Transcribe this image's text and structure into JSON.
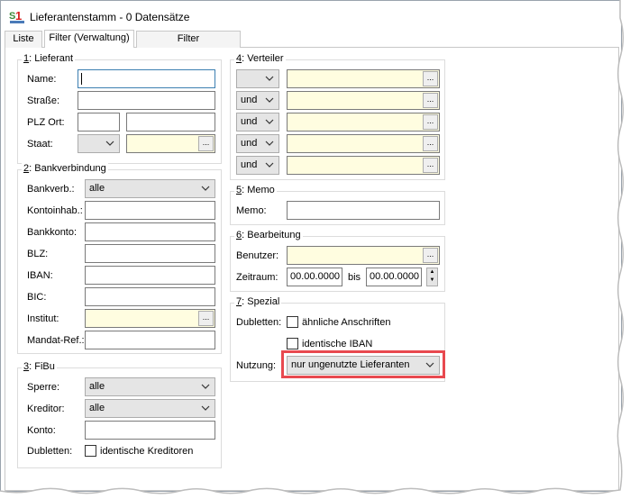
{
  "window": {
    "title": "Lieferantenstamm - 0 Datensätze"
  },
  "tabs": [
    {
      "label": "Liste"
    },
    {
      "label": "Filter (Verwaltung)"
    },
    {
      "label": "Filter (Ansprechpartner)"
    }
  ],
  "ellipsis": "...",
  "lieferant": {
    "num": "1",
    "title": ": Lieferant",
    "name_label": "Name:",
    "strasse_label": "Straße:",
    "plzort_label": "PLZ Ort:",
    "staat_label": "Staat:"
  },
  "bank": {
    "num": "2",
    "title": ": Bankverbindung",
    "bankverb_label": "Bankverb.:",
    "bankverb_value": "alle",
    "kontoinhab_label": "Kontoinhab.:",
    "bankkonto_label": "Bankkonto:",
    "blz_label": "BLZ:",
    "iban_label": "IBAN:",
    "bic_label": "BIC:",
    "institut_label": "Institut:",
    "mandat_label": "Mandat-Ref.:"
  },
  "fibu": {
    "num": "3",
    "title": ": FiBu",
    "sperre_label": "Sperre:",
    "sperre_value": "alle",
    "kreditor_label": "Kreditor:",
    "kreditor_value": "alle",
    "konto_label": "Konto:",
    "dubletten_label": "Dubletten:",
    "dubletten_check_label": "identische Kreditoren"
  },
  "verteiler": {
    "num": "4",
    "title": ": Verteiler",
    "row_ops": [
      "",
      "und",
      "und",
      "und",
      "und"
    ]
  },
  "memo": {
    "num": "5",
    "title": ": Memo",
    "memo_label": "Memo:"
  },
  "bearbeitung": {
    "num": "6",
    "title": ": Bearbeitung",
    "benutzer_label": "Benutzer:",
    "zeitraum_label": "Zeitraum:",
    "date_from": "00.00.0000",
    "bis_label": "bis",
    "date_to": "00.00.0000"
  },
  "spezial": {
    "num": "7",
    "title": ": Spezial",
    "dubletten_label": "Dubletten:",
    "check_anschriften": "ähnliche Anschriften",
    "check_iban": "identische IBAN",
    "nutzung_label": "Nutzung:",
    "nutzung_value": "nur ungenutzte Lieferanten"
  },
  "colors": {
    "highlight": "#e8494f",
    "lookup_field": "#fffde0"
  }
}
